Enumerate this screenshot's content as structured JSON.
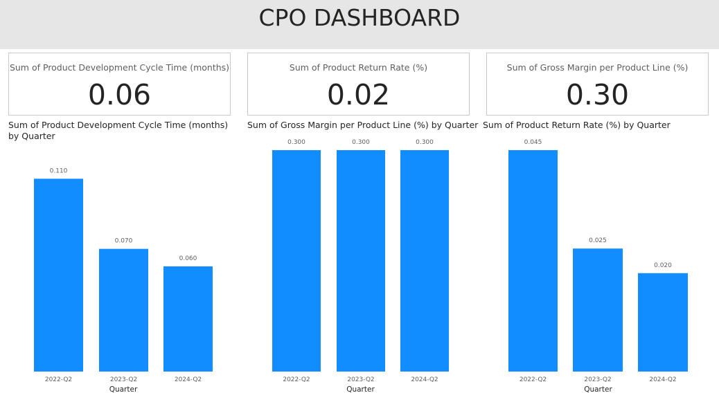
{
  "header": {
    "title": "CPO DASHBOARD"
  },
  "cards": [
    {
      "label": "Sum of Product Development Cycle Time (months)",
      "value": "0.06"
    },
    {
      "label": "Sum of Product Return Rate (%)",
      "value": "0.02"
    },
    {
      "label": "Sum of Gross Margin per Product Line (%)",
      "value": "0.30"
    }
  ],
  "colors": {
    "bar": "#118DFF",
    "header_bg": "#E6E6E6"
  },
  "chart_data": [
    {
      "type": "bar",
      "title": "Sum of Product Development Cycle Time (months) by Quarter",
      "xlabel": "Quarter",
      "ylabel": "",
      "categories": [
        "2022-Q2",
        "2023-Q2",
        "2024-Q2"
      ],
      "values": [
        0.11,
        0.07,
        0.06
      ],
      "data_labels": [
        "0.110",
        "0.070",
        "0.060"
      ],
      "ylim": [
        0,
        0.12
      ],
      "grid": false,
      "legend": "none"
    },
    {
      "type": "bar",
      "title": "Sum of Gross Margin per Product Line (%) by Quarter",
      "xlabel": "Quarter",
      "ylabel": "",
      "categories": [
        "2022-Q2",
        "2023-Q2",
        "2024-Q2"
      ],
      "values": [
        0.3,
        0.3,
        0.3
      ],
      "data_labels": [
        "0.300",
        "0.300",
        "0.300"
      ],
      "ylim": [
        0,
        0.3
      ],
      "grid": false,
      "legend": "none"
    },
    {
      "type": "bar",
      "title": "Sum of Product Return Rate (%) by Quarter",
      "xlabel": "Quarter",
      "ylabel": "",
      "categories": [
        "2022-Q2",
        "2023-Q2",
        "2024-Q2"
      ],
      "values": [
        0.045,
        0.025,
        0.02
      ],
      "data_labels": [
        "0.045",
        "0.025",
        "0.020"
      ],
      "ylim": [
        0,
        0.045
      ],
      "grid": false,
      "legend": "none"
    }
  ]
}
